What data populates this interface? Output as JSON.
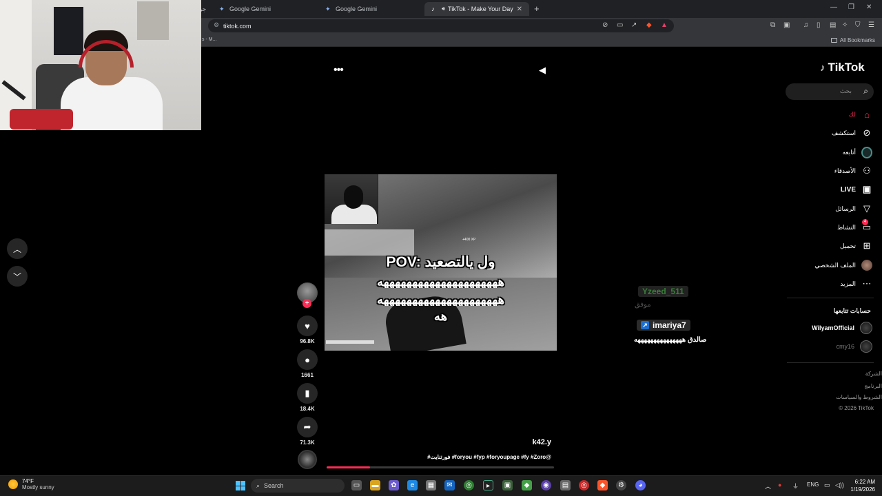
{
  "browser": {
    "tabs": [
      {
        "label": "Google Gemini",
        "active": false
      },
      {
        "label": "Google Gemini",
        "active": false
      },
      {
        "label": "TikTok - Make Your Day",
        "active": true
      }
    ],
    "left_tab_fragment": "جو",
    "new_tab": "+",
    "address": "tiktok.com",
    "bookmarks_left_fragment": "s - M...",
    "all_bookmarks": "All Bookmarks"
  },
  "tiktok": {
    "logo_text": "TikTok",
    "search_placeholder": "بحث",
    "nav": [
      {
        "label": "لك",
        "icon": "home-icon",
        "active": true
      },
      {
        "label": "استكشف",
        "icon": "compass-icon",
        "active": false
      },
      {
        "label": "أتابعه",
        "icon": "following-icon",
        "active": false
      },
      {
        "label": "الأصدقاء",
        "icon": "friends-icon",
        "active": false
      },
      {
        "label": "LIVE",
        "icon": "live-icon",
        "active": false
      },
      {
        "label": "الرسائل",
        "icon": "messages-icon",
        "active": false
      },
      {
        "label": "النشاط",
        "icon": "activity-icon",
        "active": false,
        "badge": "4"
      },
      {
        "label": "تحميل",
        "icon": "upload-icon",
        "active": false
      },
      {
        "label": "الملف الشخصي",
        "icon": "profile-icon",
        "active": false
      },
      {
        "label": "المزيد",
        "icon": "more-icon",
        "active": false
      }
    ],
    "following_title": "حسابات تتابعها",
    "following_accounts": [
      {
        "name": "WilyamOfficial"
      },
      {
        "name": "cmy16"
      }
    ],
    "footer": [
      "الشركة",
      "البرنامج",
      "الشروط والسياسات",
      "© 2026 TikTok"
    ],
    "video": {
      "caption_lines": [
        "POV: ول يالتصعيد",
        "هههههههههههههههههههههه",
        "هههههههههههههههههههههه",
        "هه"
      ],
      "xp_text": "+400 XP",
      "author": "k42.y",
      "description": "#فورتنايت #foryou #fyp #foryoupage #fy #Zoro@",
      "progress": 0.19
    },
    "actions": [
      {
        "name": "like",
        "icon": "heart-icon",
        "count": "96.8K"
      },
      {
        "name": "comment",
        "icon": "comment-icon",
        "count": "1661"
      },
      {
        "name": "save",
        "icon": "bookmark-icon",
        "count": "18.4K"
      },
      {
        "name": "share",
        "icon": "share-icon",
        "count": "71.3K"
      }
    ],
    "follow_plus": "+"
  },
  "comments": {
    "top_user": "Yzeed_511",
    "top_text": "موفق",
    "user": "imariya7",
    "text": "صالدق هههههههههههههههه"
  },
  "taskbar": {
    "temperature": "74°F",
    "weather": "Mostly sunny",
    "search_label": "Search",
    "language": "ENG",
    "time": "6:22 AM",
    "date": "1/19/2026"
  },
  "colors": {
    "tiktok_red": "#fe2c55",
    "background": "#000000",
    "chrome_dark": "#202124",
    "chrome_mid": "#35363a"
  }
}
